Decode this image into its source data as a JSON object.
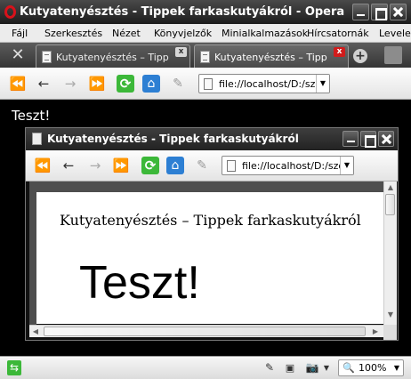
{
  "window": {
    "title": "Kutyatenyésztés - Tippek farkaskutyákról - Opera"
  },
  "menu": [
    "Fájl",
    "Szerkesztés",
    "Nézet",
    "Könyvjelzők",
    "Minialkalmazások",
    "Hírcsatornák",
    "Levelek"
  ],
  "tabs": [
    {
      "label": "Kutyatenyésztés – Tipp",
      "active": false
    },
    {
      "label": "Kutyatenyésztés – Tipp",
      "active": true
    }
  ],
  "address": {
    "url": "file://localhost/D:/szok"
  },
  "page": {
    "outer_text": "Teszt!"
  },
  "inner_window": {
    "title": "Kutyatenyésztés - Tippek farkaskutyákról",
    "address": "file://localhost/D:/szok",
    "heading": "Kutyatenyésztés – Tippek farkaskutyákról",
    "text": "Teszt!"
  },
  "status": {
    "zoom": "100%"
  },
  "icons": {
    "rewind": "⏪",
    "back": "←",
    "forward": "→",
    "fast_forward": "⏩",
    "reload": "⟳",
    "home": "⌂",
    "edit": "✎",
    "settings": "✕",
    "new_tab": "+",
    "trash": "🗑",
    "sync": "⇆",
    "pencil": "✎",
    "camera": "📷",
    "scroll_up": "▲",
    "scroll_down": "▼",
    "scroll_left": "◀",
    "scroll_right": "▶",
    "dropdown": "▼",
    "close": "x"
  },
  "colors": {
    "title_bar": "#2a2a2a",
    "tab_close_active": "#d01c1c",
    "reload_green": "#3cb839",
    "home_blue": "#2d7fd3"
  }
}
